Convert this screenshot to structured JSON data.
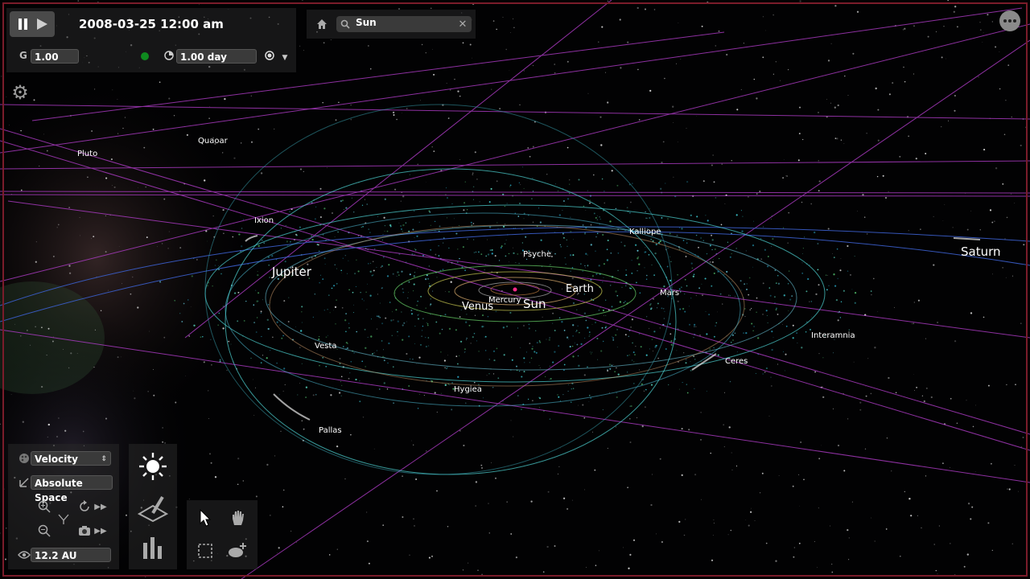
{
  "top_bar": {
    "date_time": "2008-03-25 12:00 am",
    "g_label": "G",
    "g_value": "1.00",
    "timestep": "1.00 day"
  },
  "search": {
    "query": "Sun"
  },
  "left_panel": {
    "color_mode": "Velocity",
    "frame_mode": "Absolute Space",
    "distance": "12.2 AU"
  },
  "bodies": {
    "pluto": "Pluto",
    "quaoar": "Quaoar",
    "ixion": "Ixion",
    "jupiter": "Jupiter",
    "psyche": "Psyche",
    "kalliope": "Kalliope",
    "earth": "Earth",
    "mercury": "Mercury",
    "venus": "Venus",
    "sun": "Sun",
    "mars": "Mars",
    "saturn": "Saturn",
    "interamnia": "Interamnia",
    "vesta": "Vesta",
    "ceres": "Ceres",
    "hygiea": "Hygiea",
    "pallas": "Pallas"
  },
  "colors": {
    "frame": "#7a1c2a",
    "orbit_cyan": "#4fd6d6",
    "orbit_magenta": "#b03cc8",
    "sun_dot": "#ff2a8a"
  }
}
